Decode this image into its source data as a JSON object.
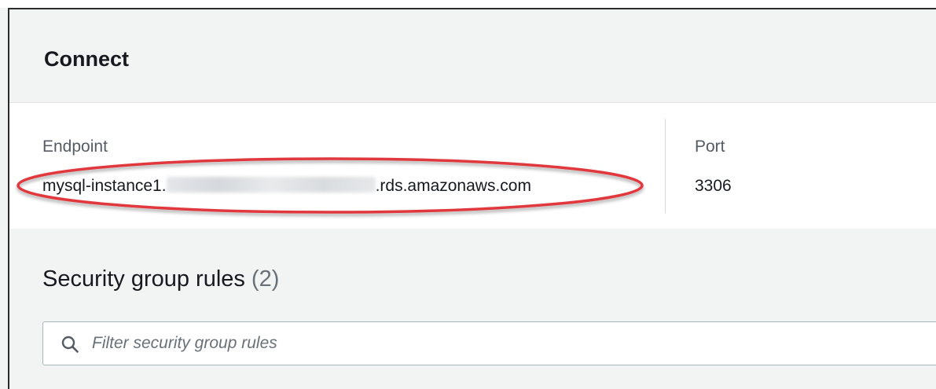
{
  "connect": {
    "title": "Connect"
  },
  "endpoint": {
    "label": "Endpoint",
    "value_prefix": "mysql-instance1.",
    "value_suffix": ".rds.amazonaws.com"
  },
  "port": {
    "label": "Port",
    "value": "3306"
  },
  "security_group_rules": {
    "title": "Security group rules",
    "count": "(2)",
    "filter_placeholder": "Filter security group rules",
    "filter_value": ""
  },
  "colors": {
    "highlight": "#e0383e",
    "panel_bg": "#f2f3f3",
    "text_primary": "#16191f",
    "text_secondary": "#545b64"
  },
  "icons": {
    "filter": "search-icon"
  }
}
